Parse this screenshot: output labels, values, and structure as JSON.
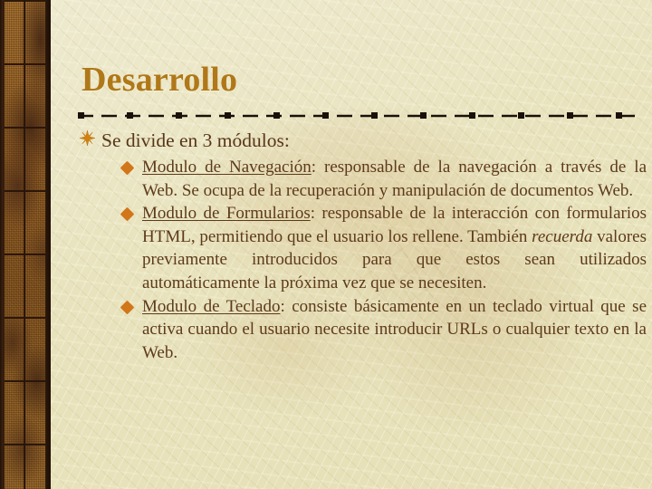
{
  "slide": {
    "title": "Desarrollo",
    "title_color": "#b07818",
    "body_color": "#5d3a1b",
    "background_color": "#e9e4c2",
    "accent_color": "#d2761a",
    "border_color": "#9a6426"
  },
  "divider": {
    "name": "dash-dot-divider",
    "style": "dash-dot with square markers",
    "color": "#1a1008",
    "marker_count": 12
  },
  "bullets": {
    "level1": {
      "marker": "six-point-star-bullet",
      "text": "Se divide en 3 módulos:"
    },
    "level2_marker": "diamond-bullet",
    "items": [
      {
        "name": "modulo-navegacion",
        "heading": "Modulo de Navegación",
        "separator": ": ",
        "body_1": "responsable de la navegación a través de la Web. Se ocupa de la recuperación y manipulación de documentos Web.",
        "emphasis": "",
        "body_2": ""
      },
      {
        "name": "modulo-formularios",
        "heading": "Modulo de Formularios",
        "separator": ": ",
        "body_1": "responsable de la interacción con formularios HTML, permitiendo que el usuario los rellene. También ",
        "emphasis": "recuerda",
        "body_2": " valores previamente introducidos para que estos sean utilizados automáticamente la próxima vez que se necesiten."
      },
      {
        "name": "modulo-teclado",
        "heading": "Modulo de Teclado",
        "separator": ": ",
        "body_1": "consiste básicamente en un teclado virtual que se activa cuando el usuario necesite introducir URLs o cualquier texto en la Web.",
        "emphasis": "",
        "body_2": ""
      }
    ]
  }
}
